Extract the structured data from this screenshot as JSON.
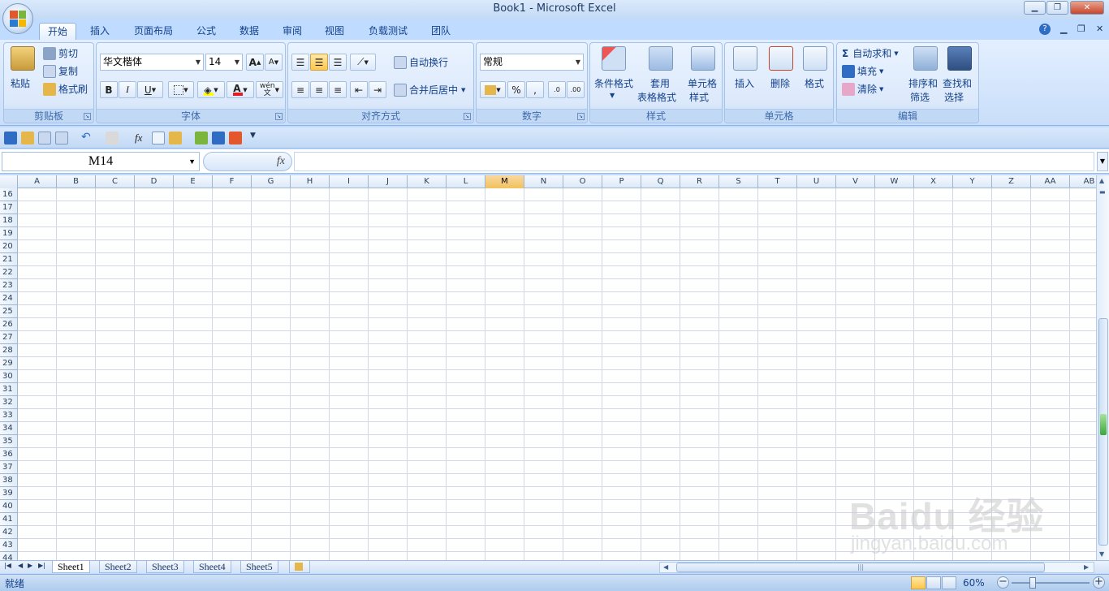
{
  "window": {
    "title": "Book1 - Microsoft Excel"
  },
  "tabs": [
    "开始",
    "插入",
    "页面布局",
    "公式",
    "数据",
    "审阅",
    "视图",
    "负载测试",
    "团队"
  ],
  "ribbon": {
    "clipboard": {
      "label": "剪贴板",
      "paste": "粘贴",
      "cut": "剪切",
      "copy": "复制",
      "format_painter": "格式刷"
    },
    "font": {
      "label": "字体",
      "font_name": "华文楷体",
      "font_size": "14",
      "bold": "B",
      "italic": "I",
      "underline": "U",
      "wen": "wén",
      "wen_char": "文"
    },
    "alignment": {
      "label": "对齐方式",
      "wrap_text": "自动换行",
      "merge_center": "合并后居中"
    },
    "number": {
      "label": "数字",
      "format": "常规",
      "percent": "%",
      "comma": ","
    },
    "styles": {
      "label": "样式",
      "conditional_formatting": "条件格式",
      "format_as_table_1": "套用",
      "format_as_table_2": "表格格式",
      "cell_styles_1": "单元格",
      "cell_styles_2": "样式"
    },
    "cells": {
      "label": "单元格",
      "insert": "插入",
      "delete": "删除",
      "format": "格式"
    },
    "editing": {
      "label": "编辑",
      "autosum": "自动求和",
      "fill": "填充",
      "clear": "清除",
      "sort_filter_1": "排序和",
      "sort_filter_2": "筛选",
      "find_select_1": "查找和",
      "find_select_2": "选择"
    }
  },
  "formula_bar": {
    "name_box": "M14",
    "fx": "fx",
    "value": ""
  },
  "grid": {
    "columns": [
      "A",
      "B",
      "C",
      "D",
      "E",
      "F",
      "G",
      "H",
      "I",
      "J",
      "K",
      "L",
      "M",
      "N",
      "O",
      "P",
      "Q",
      "R",
      "S",
      "T",
      "U",
      "V",
      "W",
      "X",
      "Y",
      "Z",
      "AA",
      "AB"
    ],
    "selected_column": "M",
    "rows": [
      "16",
      "17",
      "18",
      "19",
      "20",
      "21",
      "22",
      "23",
      "24",
      "25",
      "26",
      "27",
      "28",
      "29",
      "30",
      "31",
      "32",
      "33",
      "34",
      "35",
      "36",
      "37",
      "38",
      "39",
      "40",
      "41",
      "42",
      "43",
      "44"
    ]
  },
  "sheets": [
    "Sheet1",
    "Sheet2",
    "Sheet3",
    "Sheet4",
    "Sheet5"
  ],
  "active_sheet": "Sheet1",
  "status": {
    "ready": "就绪",
    "zoom": "60%"
  },
  "watermark": {
    "main": "Baidu 经验",
    "sub": "jingyan.baidu.com"
  }
}
